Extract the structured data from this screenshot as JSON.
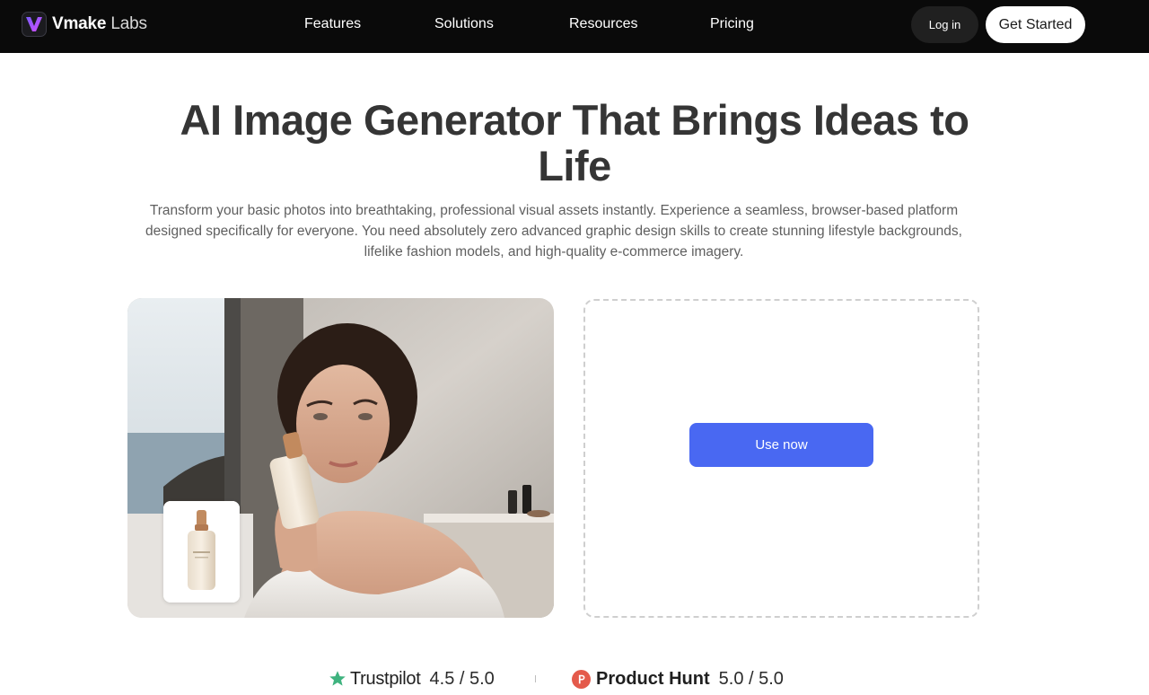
{
  "header": {
    "logo_brand": "Vmake",
    "logo_suffix": "Labs",
    "nav": [
      "Features",
      "Solutions",
      "Resources",
      "Pricing"
    ],
    "login_label": "Log in",
    "get_started_label": "Get Started"
  },
  "hero": {
    "title": "AI Image Generator That Brings Ideas to Life",
    "subtitle": "Transform your basic photos into breathtaking, professional visual assets instantly. Experience a seamless, browser-based platform designed specifically for everyone. You need absolutely zero advanced graphic design skills to create stunning lifestyle backgrounds, lifelike fashion models, and high-quality e-commerce imagery."
  },
  "cta": {
    "use_now_label": "Use now"
  },
  "ratings": [
    {
      "name": "Trustpilot",
      "score": "4.5 / 5.0",
      "icon": "star-icon",
      "color": "#3fb37f"
    },
    {
      "name": "Product Hunt",
      "score": "5.0 / 5.0",
      "icon": "product-hunt-icon",
      "color": "#e45a4b"
    }
  ],
  "colors": {
    "header_bg": "#0a0a0a",
    "accent": "#4968f2"
  }
}
